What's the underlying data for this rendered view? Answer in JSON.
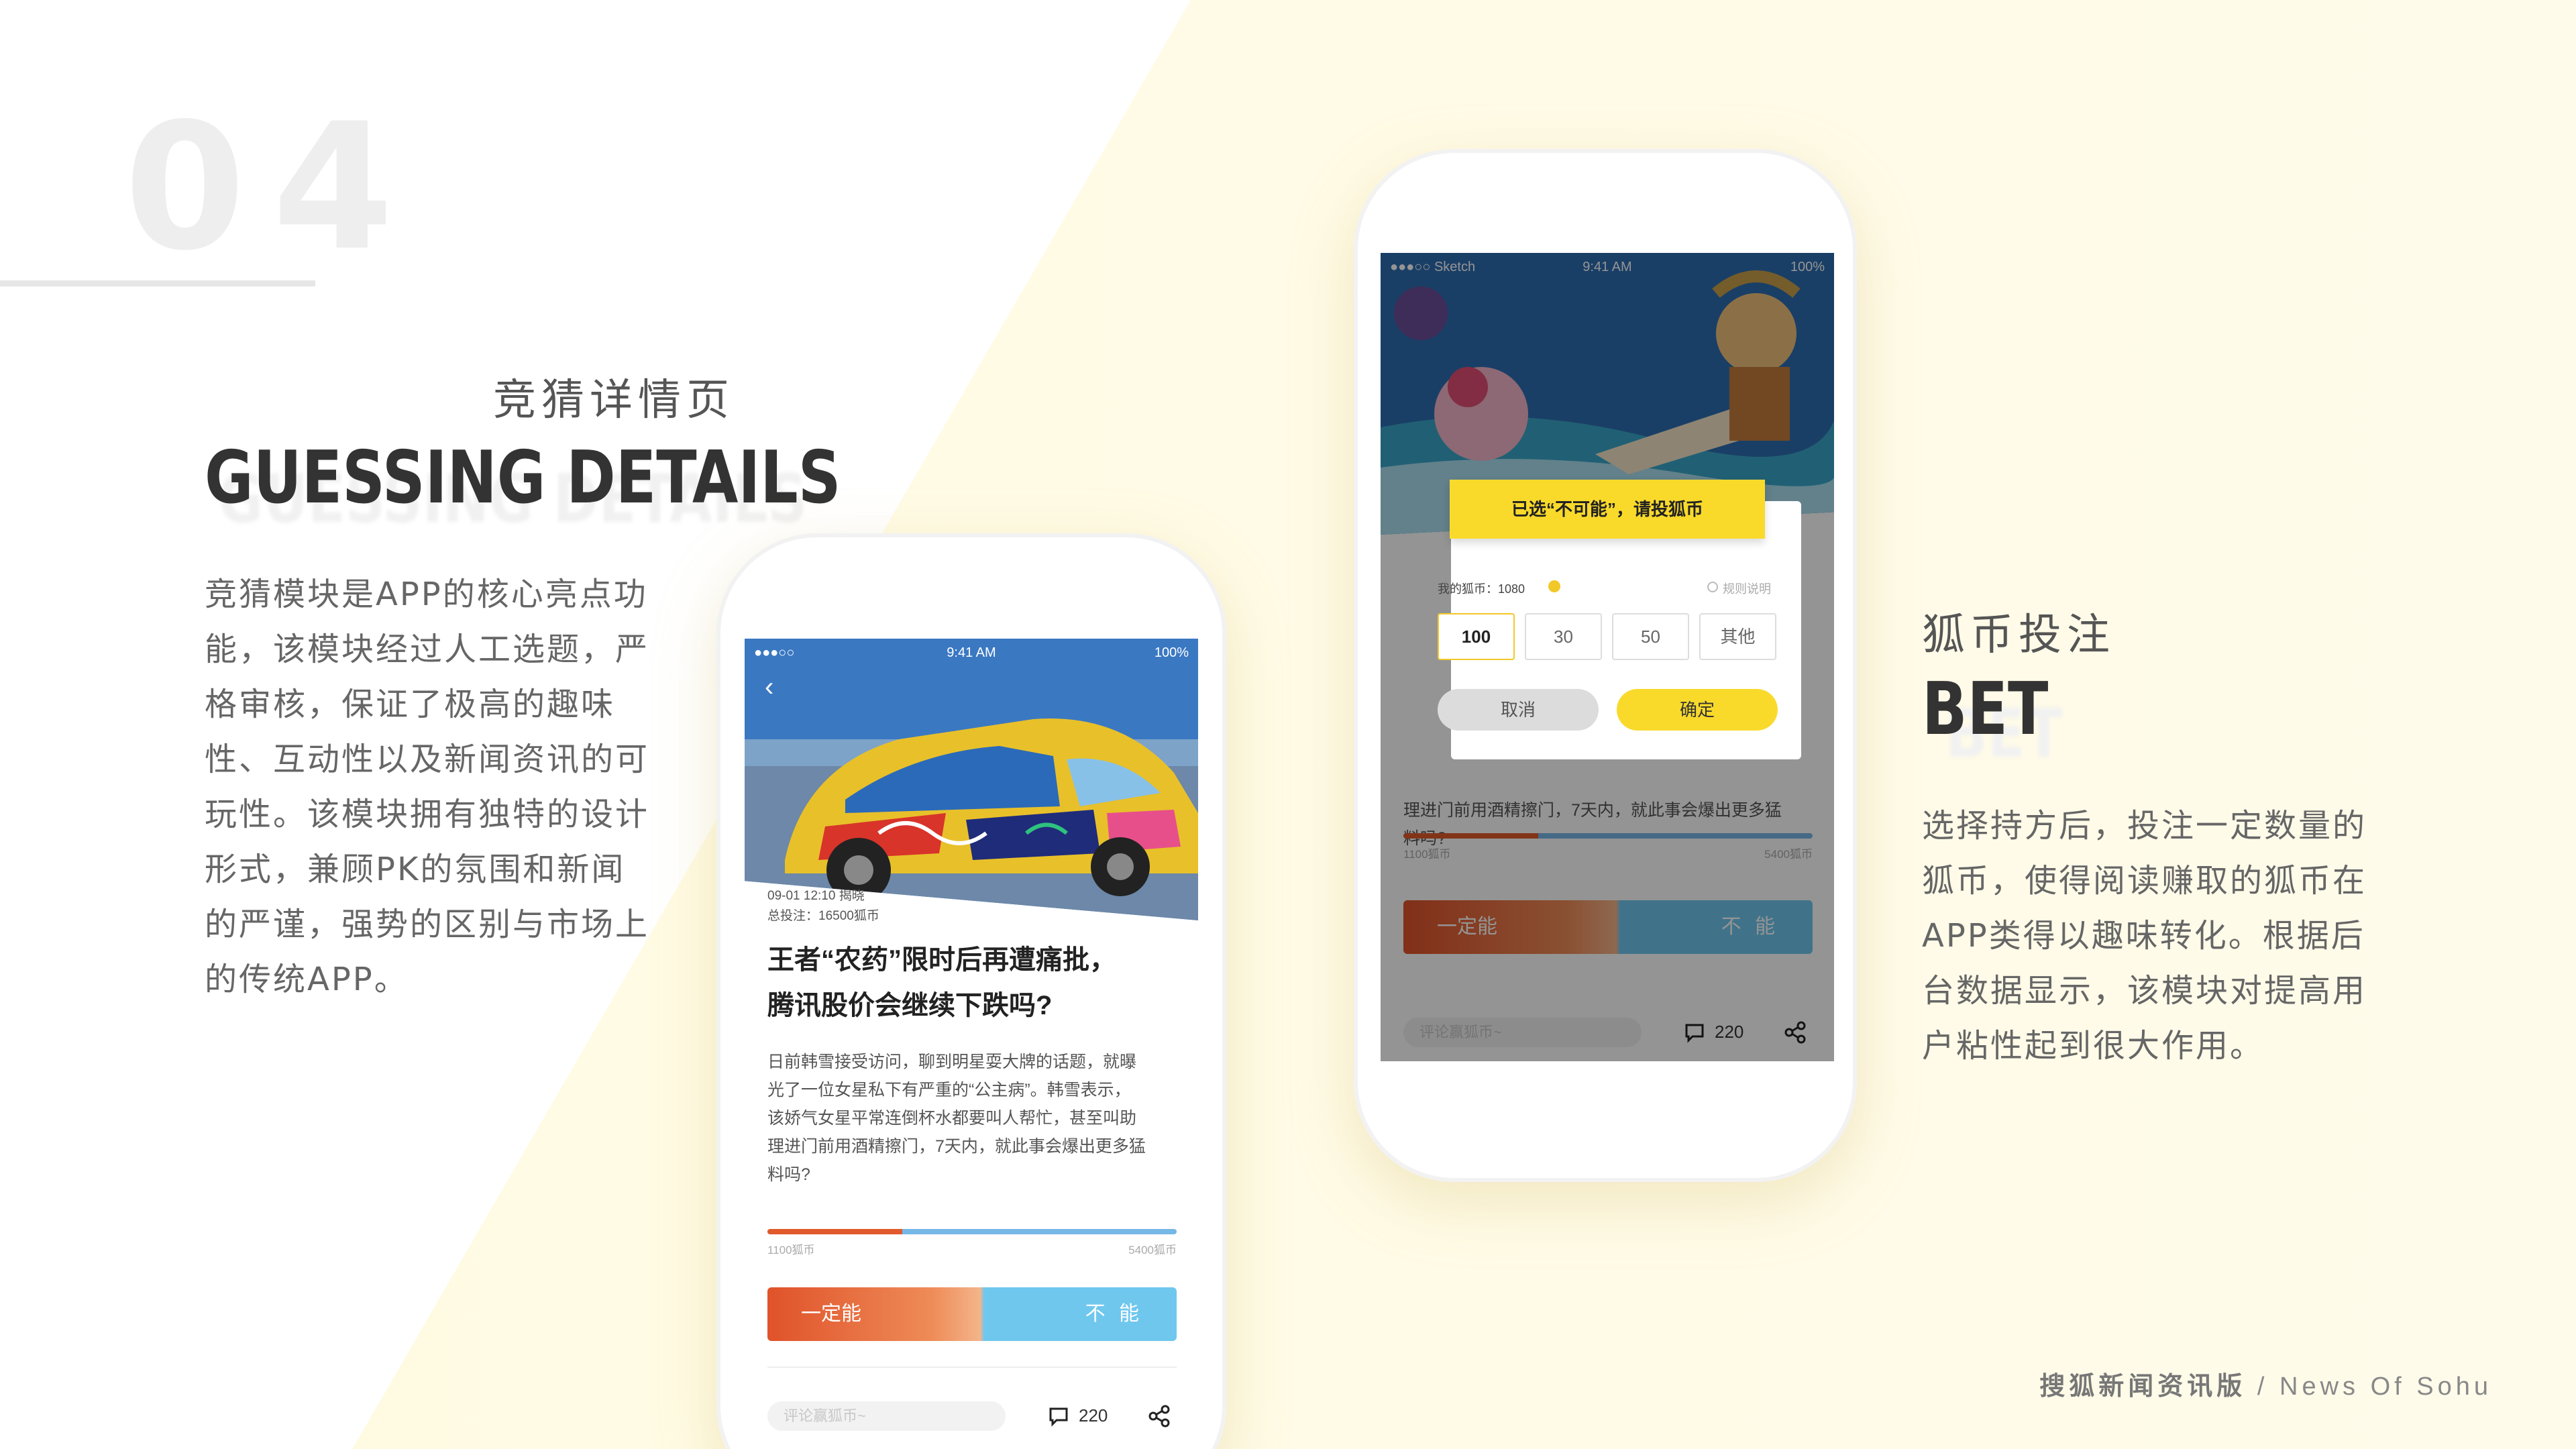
{
  "section_number": "04",
  "left": {
    "title_cn": "竞猜详情页",
    "title_en": "GUESSING DETAILS",
    "body_lines": [
      "竞猜模块是APP的核心亮点功",
      "能，该模块经过人工选题，严",
      "格审核，保证了极高的趣味",
      "性、互动性以及新闻资讯的可",
      "玩性。该模块拥有独特的设计",
      "形式，兼顾PK的氛围和新闻",
      "的严谨，强势的区别与市场上",
      "的传统APP。"
    ]
  },
  "right": {
    "title_cn": "狐币投注",
    "title_en": "BET",
    "body_lines": [
      "选择持方后，投注一定数量的",
      "狐币，使得阅读赚取的狐币在",
      "APP类得以趣味转化。根据后",
      "台数据显示，该模块对提高用",
      "户粘性起到很大作用。"
    ]
  },
  "phone1": {
    "status_left": "●●●○○",
    "status_time": "9:41 AM",
    "status_battery": "100%",
    "meta_time": "09-01 12:10 揭晓",
    "meta_total": "总投注：16500狐币",
    "headline_line1": "王者“农药”限时后再遭痛批，",
    "headline_line2": "腾讯股价会继续下跌吗?",
    "body_lines": [
      "日前韩雪接受访问，聊到明星耍大牌的话题，就曝",
      "光了一位女星私下有严重的“公主病”。韩雪表示，",
      "该娇气女星平常连倒杯水都要叫人帮忙，甚至叫助",
      "理进门前用酒精擦门，7天内，就此事会爆出更多猛",
      "料吗?"
    ],
    "progress_ratio": 0.33,
    "left_coins": "1100狐币",
    "right_coins": "5400狐币",
    "yes_label": "一定能",
    "no_label": "不 能",
    "comment_placeholder": "评论赢狐币~",
    "comment_count": "220"
  },
  "phone2": {
    "status_left": "●●●○○ Sketch",
    "status_time": "9:41 AM",
    "status_battery": "100%",
    "banner": "已选“不可能”，请投狐币",
    "my_coins": "我的狐币：1080",
    "rules": "规则说明",
    "options": [
      "100",
      "30",
      "50",
      "其他"
    ],
    "selected_option": "100",
    "cancel": "取消",
    "confirm": "确定",
    "bg_body_line": "理进门前用酒精擦门，7天内，就此事会爆出更多猛",
    "bg_body_line2": "料吗?",
    "progress_ratio": 0.33,
    "left_coins": "1100狐币",
    "right_coins": "5400狐币",
    "yes_label": "一定能",
    "no_label": "不 能",
    "comment_placeholder": "评论赢狐币~",
    "comment_count": "220"
  },
  "footer": {
    "cn": "搜狐新闻资讯版",
    "sep": "/",
    "en": "News Of Sohu"
  },
  "colors": {
    "accent_yellow": "#f9da2b",
    "accent_red": "#e05a2b",
    "accent_blue": "#6fc7ee",
    "bg_yellow": "#fefbe6"
  }
}
